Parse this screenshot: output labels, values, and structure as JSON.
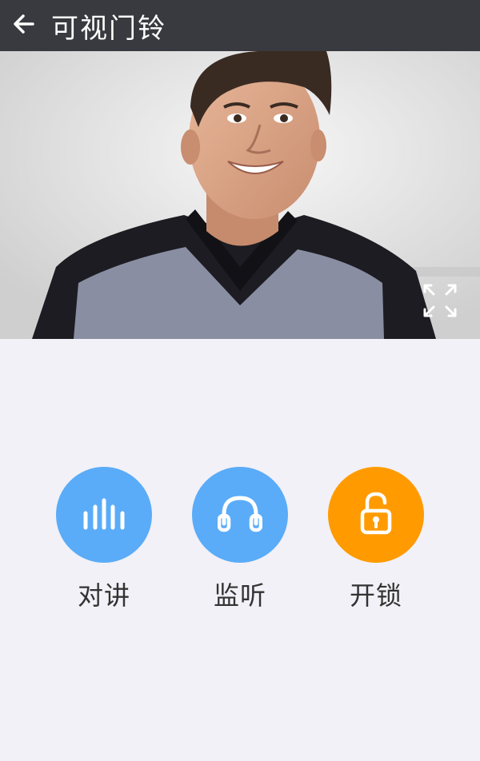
{
  "header": {
    "title": "可视门铃",
    "back_icon": "arrow-left-icon",
    "background": "#393a3f"
  },
  "video": {
    "fullscreen_icon": "expand-icon"
  },
  "actions": [
    {
      "label": "对讲",
      "icon": "audio-bars-icon",
      "color": "#5aacf8"
    },
    {
      "label": "监听",
      "icon": "headphones-icon",
      "color": "#5aacf8"
    },
    {
      "label": "开锁",
      "icon": "unlock-icon",
      "color": "#ff9b00"
    }
  ]
}
